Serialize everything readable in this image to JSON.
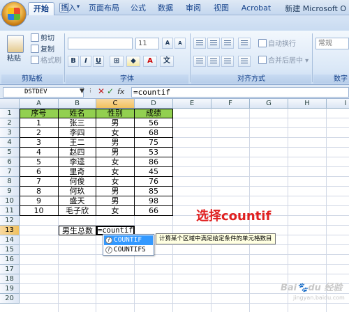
{
  "window": {
    "title": "新建 Microsoft O"
  },
  "ribbon": {
    "tabs": [
      "开始",
      "插入",
      "页面布局",
      "公式",
      "数据",
      "审阅",
      "视图",
      "Acrobat"
    ],
    "active_tab": "开始",
    "clipboard": {
      "paste": "粘贴",
      "cut": "剪切",
      "copy": "复制",
      "format_painter": "格式刷",
      "label": "剪贴板"
    },
    "font": {
      "size": "11",
      "bold": "B",
      "italic": "I",
      "underline": "U",
      "color_a": "A",
      "wen": "文",
      "label": "字体"
    },
    "alignment": {
      "wrap": "自动换行",
      "merge": "合并后居中",
      "label": "对齐方式"
    },
    "number": {
      "format": "常规",
      "label": "数字"
    }
  },
  "formula_bar": {
    "name_box": "DSTDEV",
    "fx": "fx",
    "formula": "=countif"
  },
  "columns": [
    "A",
    "B",
    "C",
    "D",
    "E",
    "F",
    "G",
    "H",
    "I"
  ],
  "selected_column": "C",
  "rows": [
    "1",
    "2",
    "3",
    "4",
    "5",
    "6",
    "7",
    "8",
    "9",
    "10",
    "11",
    "12",
    "13",
    "14",
    "15",
    "16",
    "17",
    "18",
    "19",
    "20"
  ],
  "selected_row": "13",
  "table": {
    "headers": [
      "序号",
      "姓名",
      "性别",
      "成绩"
    ],
    "rows": [
      [
        "1",
        "张三",
        "男",
        "56"
      ],
      [
        "2",
        "李四",
        "女",
        "68"
      ],
      [
        "3",
        "王二",
        "男",
        "75"
      ],
      [
        "4",
        "赵四",
        "男",
        "53"
      ],
      [
        "5",
        "李逵",
        "女",
        "86"
      ],
      [
        "6",
        "里奇",
        "女",
        "45"
      ],
      [
        "7",
        "何俊",
        "女",
        "76"
      ],
      [
        "8",
        "何玖",
        "男",
        "85"
      ],
      [
        "9",
        "盛天",
        "男",
        "98"
      ],
      [
        "10",
        "毛子欣",
        "女",
        "66"
      ]
    ]
  },
  "summary": {
    "label": "男生总数",
    "editing": "=countif"
  },
  "autocomplete": {
    "items": [
      "COUNTIF",
      "COUNTIFS"
    ],
    "tooltip": "计算某个区域中满足给定条件的单元格数目"
  },
  "annotation": "选择countif",
  "watermark": {
    "main": "Bai du 经验",
    "sub": "jingyan.baidu.com"
  },
  "colors": {
    "header_fill": "#92d050",
    "annotation": "#e02020",
    "selection": "#3399ff"
  }
}
